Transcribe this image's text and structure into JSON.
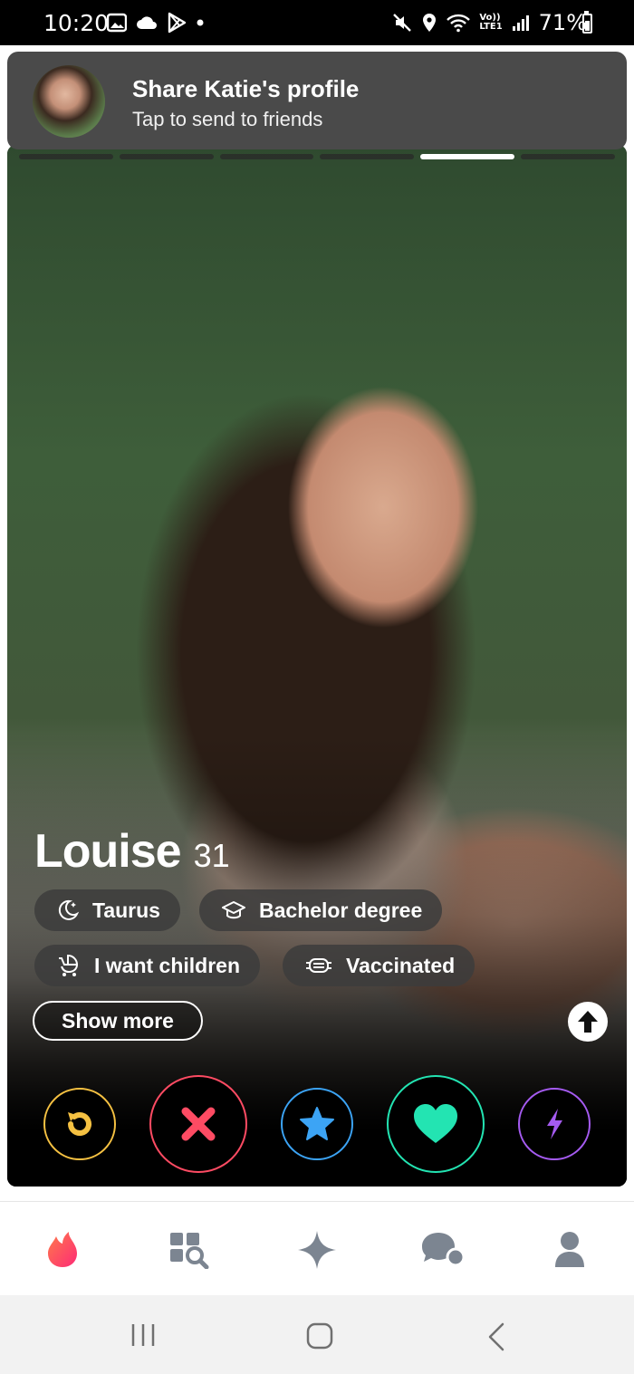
{
  "status_bar": {
    "time": "10:20",
    "battery_percent": "71%",
    "network_label_top": "Vo))",
    "network_label_bottom": "LTE1"
  },
  "share_banner": {
    "title": "Share Katie's profile",
    "subtitle": "Tap to send to friends"
  },
  "photo_progress": {
    "total": 6,
    "active_index": 4
  },
  "profile": {
    "name": "Louise",
    "age": "31",
    "chips": [
      {
        "icon": "moon-icon",
        "label": "Taurus"
      },
      {
        "icon": "graduation-cap-icon",
        "label": "Bachelor degree"
      },
      {
        "icon": "baby-stroller-icon",
        "label": "I want children"
      },
      {
        "icon": "face-mask-icon",
        "label": "Vaccinated"
      }
    ],
    "show_more_label": "Show more"
  },
  "actions": [
    {
      "name": "rewind-button",
      "icon": "rewind-icon",
      "color": "#f5c142"
    },
    {
      "name": "nope-button",
      "icon": "x-icon",
      "color": "#fe4b63"
    },
    {
      "name": "super-like-button",
      "icon": "star-icon",
      "color": "#3ca4f5"
    },
    {
      "name": "like-button",
      "icon": "heart-icon",
      "color": "#23e4b2"
    },
    {
      "name": "boost-button",
      "icon": "lightning-icon",
      "color": "#a55bf1"
    }
  ],
  "bottom_nav": [
    {
      "name": "nav-discover",
      "icon": "flame-icon",
      "active": true
    },
    {
      "name": "nav-explore",
      "icon": "explore-grid-icon",
      "active": false
    },
    {
      "name": "nav-top-picks",
      "icon": "sparkle-icon",
      "active": false
    },
    {
      "name": "nav-messages",
      "icon": "chat-bubbles-icon",
      "active": false
    },
    {
      "name": "nav-profile",
      "icon": "person-icon",
      "active": false
    }
  ],
  "colors": {
    "brand_flame": "#fd3f6f",
    "nav_inactive": "#7c8591",
    "chip_bg": "#3c3c3c"
  }
}
